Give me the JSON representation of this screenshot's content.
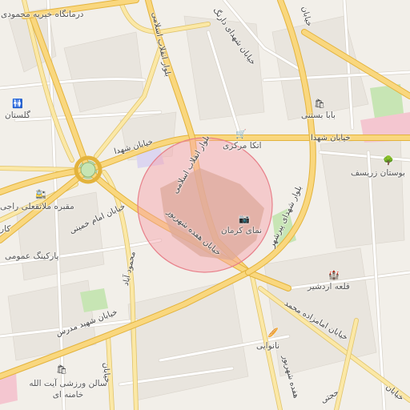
{
  "map": {
    "streets": {
      "shohada": "خیابان شهدا",
      "shohada_left": "خیابان شهدا",
      "enghelab": "بلوار انقلاب اسلامی",
      "enghelab_lower": "بلوار انقلاب اسلامی",
      "imam_khomeini": "خیابان امام خمینی",
      "hafdah_shahrivar": "خیابان هفده شهریور",
      "shahid_modarres": "خیابان شهید مدرس",
      "shahid_dadgar": "خیابان شهدای دارنگ",
      "imamzadeh": "خیابان امامزاده محمد",
      "mahmoud_abad": "محمود آباد",
      "shahid_beheshti_top": "خیابان",
      "shohada_pir": "بلوار شهدای پیرشهر",
      "hafdah_bottom": "هفده شهریور",
      "hojati": "حجتی",
      "bottom_left": "خیابان",
      "bottom_right": "خیابان"
    },
    "places": {
      "kheirieh": "درمانگاه خیریه محمودی",
      "golestan": "گلستان",
      "babastani": "بابا بستنی",
      "etka": "اتکا مرکزی",
      "bostan": "بوستان زریسف",
      "maghbareh": "مقبره ملاتقعلی راجی",
      "parking": "پارکینگ عمومی",
      "nama": "نمای کرمان",
      "ghaleh": "قلعه اردشیر",
      "nanvaei": "نانوایی",
      "salon": "سالن ورزشی آیت الله خامنه ای",
      "kar": "کار"
    },
    "icons": {
      "toilet": "wc-icon",
      "shop": "shop-icon",
      "cart": "cart-icon",
      "tree": "tree-icon",
      "camera": "camera-icon",
      "castle": "castle-icon",
      "bakery": "bakery-icon",
      "train": "train-icon",
      "stadium": "shop-icon"
    },
    "colors": {
      "background": "#f2efe9",
      "highlight_fill": "#f7a0a8",
      "highlight_stroke": "#e8808a",
      "park": "#c7e5b4",
      "pink_area": "#f4c6d0"
    }
  }
}
